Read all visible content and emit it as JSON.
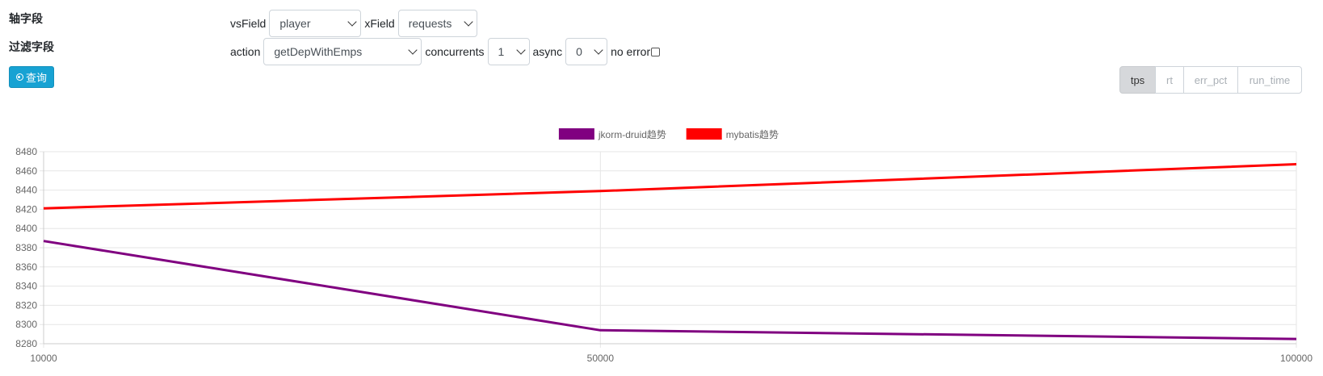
{
  "sidebar": {
    "axis_field_label": "轴字段",
    "filter_field_label": "过滤字段",
    "query_label": "查询"
  },
  "controls": {
    "vsfield_label": "vsField",
    "vsfield_value": "player",
    "xfield_label": "xField",
    "xfield_value": "requests",
    "action_label": "action",
    "action_value": "getDepWithEmps",
    "concurrents_label": "concurrents",
    "concurrents_value": "1",
    "async_label": "async",
    "async_value": "0",
    "no_error_label": "no error"
  },
  "metric_tabs": [
    {
      "label": "tps",
      "active": true
    },
    {
      "label": "rt",
      "active": false
    },
    {
      "label": "err_pct",
      "active": false
    },
    {
      "label": "run_time",
      "active": false
    }
  ],
  "chart_data": {
    "type": "line",
    "title": "",
    "xlabel": "",
    "ylabel": "",
    "x": [
      10000,
      50000,
      100000
    ],
    "x_tick_labels": [
      "10000",
      "50000",
      "100000"
    ],
    "ylim": [
      8280,
      8480
    ],
    "y_ticks": [
      "8480",
      "8460",
      "8440",
      "8420",
      "8400",
      "8380",
      "8360",
      "8340",
      "8320",
      "8300",
      "8280"
    ],
    "grid": true,
    "legend_position": "top-center",
    "series": [
      {
        "name": "jkorm-druid趋势",
        "color": "#800080",
        "values": [
          8387,
          8294,
          8285
        ]
      },
      {
        "name": "mybatis趋势",
        "color": "#ff0000",
        "values": [
          8421,
          8439,
          8467
        ]
      }
    ]
  }
}
